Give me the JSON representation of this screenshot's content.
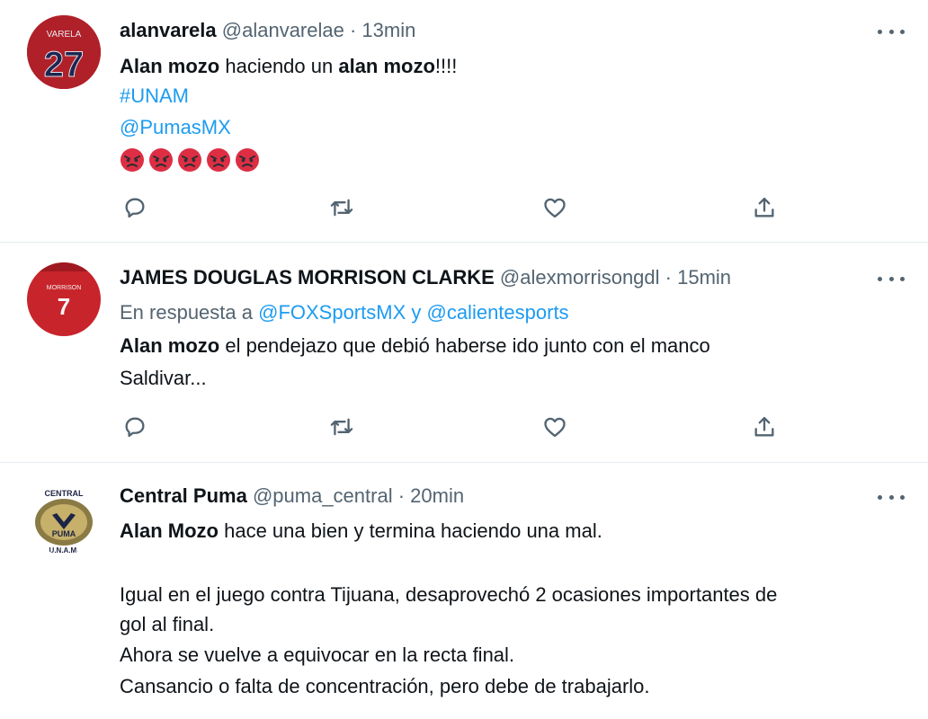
{
  "tweets": [
    {
      "name": "alanvarela",
      "handle": "@alanvarelae",
      "time": "13min",
      "avatar_text": "27",
      "avatar_top_text": "VARELA",
      "line1_bold_a": "Alan mozo",
      "line1_plain": " haciendo un ",
      "line1_bold_b": "alan mozo",
      "line1_tail": "!!!!",
      "hashtag": "#UNAM",
      "mention": "@PumasMX",
      "emoji_icon": "angry-face-icon"
    },
    {
      "name": "JAMES DOUGLAS MORRISON CLARKE",
      "handle": "@alexmorrisongdl",
      "time": "15min",
      "avatar_text": "7",
      "avatar_top_text": "MORRISON",
      "reply_prefix": "En respuesta a ",
      "reply_to_a": "@FOXSportsMX",
      "reply_join": " y ",
      "reply_to_b": "@calientesports",
      "body_bold": "Alan mozo",
      "body_line1": " el pendejazo que debió haberse ido junto con el manco",
      "body_line2": "Saldivar..."
    },
    {
      "name": "Central Puma",
      "handle": "@puma_central",
      "time": "20min",
      "avatar_top_text": "CENTRAL",
      "avatar_mid_text": "PUMA",
      "avatar_bottom_text": "U.N.A.M.",
      "body_bold": "Alan Mozo",
      "body_line1": " hace una bien y termina haciendo una mal.",
      "body_line2": "Igual en el juego contra Tijuana, desaprovechó 2 ocasiones importantes de",
      "body_line3": "gol al final.",
      "body_line4": "Ahora se vuelve a equivocar en la recta final.",
      "body_line5": "Cansancio o falta de concentración, pero debe de trabajarlo."
    }
  ],
  "separator": " · ",
  "icons": {
    "reply": "reply-icon",
    "retweet": "retweet-icon",
    "like": "heart-icon",
    "share": "share-icon",
    "more": "more-icon"
  },
  "colors": {
    "link": "#1d9bf0",
    "meta": "#536471",
    "text": "#0f1419",
    "divider": "#e6ecf0"
  }
}
